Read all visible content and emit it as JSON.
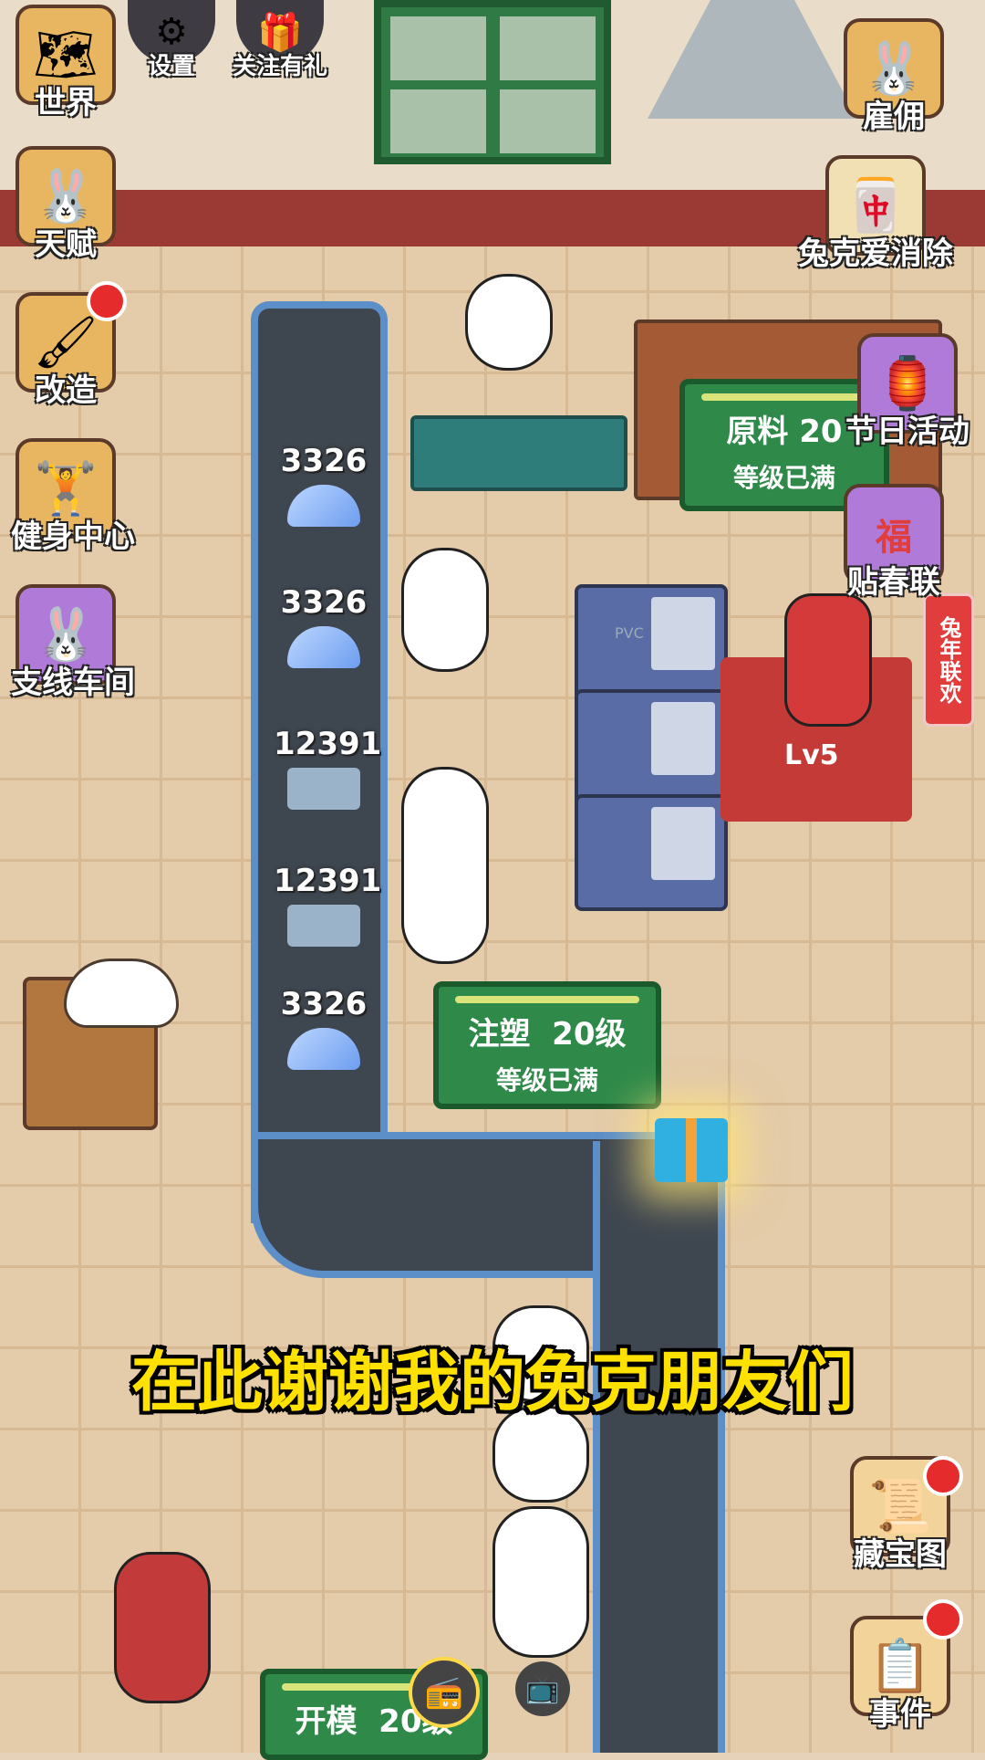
{
  "top_menu": {
    "settings": "设置",
    "follow_gift": "关注有礼"
  },
  "left_menu": [
    {
      "label": "世界",
      "icon": "map-icon"
    },
    {
      "label": "天赋",
      "icon": "talent-rabbit-icon"
    },
    {
      "label": "改造",
      "icon": "paint-roller-icon"
    },
    {
      "label": "健身中心",
      "icon": "dumbbell-rabbit-icon"
    },
    {
      "label": "支线车间",
      "icon": "workshop-rabbit-icon"
    }
  ],
  "right_menu": [
    {
      "label": "雇佣",
      "icon": "hire-rabbits-icon"
    },
    {
      "label": "兔克爱消除",
      "icon": "tile-match-icon"
    },
    {
      "label": "节日活动",
      "icon": "lantern-rabbit-icon"
    },
    {
      "label": "贴春联",
      "icon": "fu-rabbit-icon"
    },
    {
      "label": "藏宝图",
      "icon": "treasure-map-icon"
    },
    {
      "label": "事件",
      "icon": "event-scroll-icon"
    }
  ],
  "belt_items": [
    {
      "count": "3326"
    },
    {
      "count": "3326"
    },
    {
      "count": "12391"
    },
    {
      "count": "12391"
    },
    {
      "count": "3326"
    }
  ],
  "signs": {
    "raw_material": {
      "name": "原料",
      "level": "20",
      "status": "等级已满"
    },
    "injection": {
      "name": "注塑",
      "level": "20级",
      "status": "等级已满"
    },
    "mold": {
      "name": "开模",
      "level": "20级"
    }
  },
  "manager_level": "Lv5",
  "couplet_text": "兔年联欢",
  "fu_char": "福",
  "subtitle": "在此谢谢我的兔克朋友们",
  "machine_label": "PVC"
}
